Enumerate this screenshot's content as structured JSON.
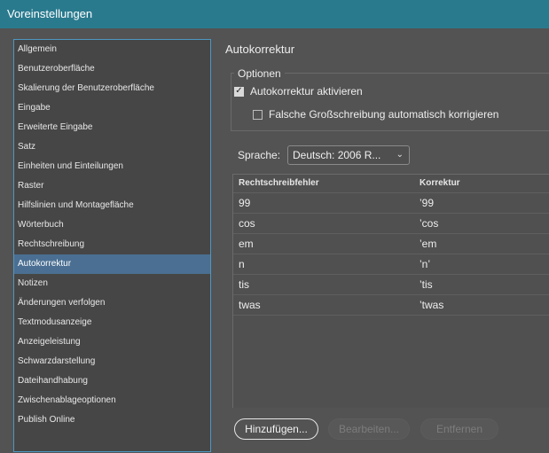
{
  "window": {
    "title": "Voreinstellungen"
  },
  "sidebar": {
    "items": [
      {
        "label": "Allgemein",
        "selected": false
      },
      {
        "label": "Benutzeroberfläche",
        "selected": false
      },
      {
        "label": "Skalierung der Benutzeroberfläche",
        "selected": false
      },
      {
        "label": "Eingabe",
        "selected": false
      },
      {
        "label": "Erweiterte Eingabe",
        "selected": false
      },
      {
        "label": "Satz",
        "selected": false
      },
      {
        "label": "Einheiten und Einteilungen",
        "selected": false
      },
      {
        "label": "Raster",
        "selected": false
      },
      {
        "label": "Hilfslinien und Montagefläche",
        "selected": false
      },
      {
        "label": "Wörterbuch",
        "selected": false
      },
      {
        "label": "Rechtschreibung",
        "selected": false
      },
      {
        "label": "Autokorrektur",
        "selected": true
      },
      {
        "label": "Notizen",
        "selected": false
      },
      {
        "label": "Änderungen verfolgen",
        "selected": false
      },
      {
        "label": "Textmodusanzeige",
        "selected": false
      },
      {
        "label": "Anzeigeleistung",
        "selected": false
      },
      {
        "label": "Schwarzdarstellung",
        "selected": false
      },
      {
        "label": "Dateihandhabung",
        "selected": false
      },
      {
        "label": "Zwischenablageoptionen",
        "selected": false
      },
      {
        "label": "Publish Online",
        "selected": false
      }
    ]
  },
  "main": {
    "section_title": "Autokorrektur",
    "options": {
      "legend": "Optionen",
      "enable_autocorrect": {
        "label": "Autokorrektur aktivieren",
        "checked": true
      },
      "fix_capitalization": {
        "label": "Falsche Großschreibung automatisch korrigieren",
        "checked": false
      }
    },
    "language": {
      "label": "Sprache:",
      "value": "Deutsch: 2006 R..."
    },
    "table": {
      "headers": [
        "Rechtschreibfehler",
        "Korrektur"
      ],
      "rows": [
        [
          "99",
          "’99"
        ],
        [
          "cos",
          "’cos"
        ],
        [
          "em",
          "’em"
        ],
        [
          "n",
          "’n’"
        ],
        [
          "tis",
          "’tis"
        ],
        [
          "twas",
          "’twas"
        ]
      ]
    },
    "buttons": {
      "add": "Hinzufügen...",
      "edit": "Bearbeiten...",
      "remove": "Entfernen"
    }
  },
  "colors": {
    "titlebar": "#2a7a8e",
    "selection": "#4a6f92",
    "background": "#535353"
  }
}
